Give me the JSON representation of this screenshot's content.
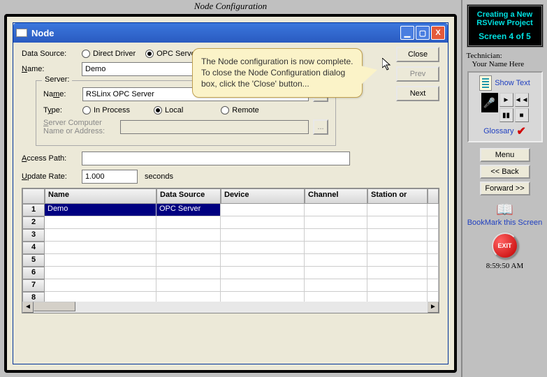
{
  "app_title": "Node Configuration",
  "window": {
    "title": "Node",
    "min_icon": "▁",
    "max_icon": "▢",
    "close_icon": "X"
  },
  "form": {
    "data_source_label": "Data Source:",
    "ds_direct": "Direct Driver",
    "ds_opc": "OPC Server",
    "name_label": "Name:",
    "name_value": "Demo",
    "server_group": "Server:",
    "server_name_label": "Name:",
    "server_name_value": "RSLinx OPC Server",
    "type_label": "Type:",
    "type_inproc": "In Process",
    "type_local": "Local",
    "type_remote": "Remote",
    "server_addr_label": "Server Computer\nName or Address:",
    "server_addr_value": "",
    "access_path_label": "Access Path:",
    "access_path_value": "",
    "update_rate_label": "Update Rate:",
    "update_rate_value": "1.000",
    "update_rate_unit": "seconds",
    "browse": "..."
  },
  "buttons": {
    "close": "Close",
    "prev": "Prev",
    "next": "Next"
  },
  "grid": {
    "headers": {
      "c2": "Name",
      "c3": "Data Source",
      "c4": "Device",
      "c5": "Channel",
      "c6": "Station or"
    },
    "rows": [
      {
        "n": "1",
        "name": "Demo",
        "ds": "OPC Server",
        "dev": "",
        "ch": "",
        "st": "",
        "selected": true
      },
      {
        "n": "2",
        "name": "",
        "ds": "",
        "dev": "",
        "ch": "",
        "st": "",
        "selected": false
      },
      {
        "n": "3",
        "name": "",
        "ds": "",
        "dev": "",
        "ch": "",
        "st": "",
        "selected": false
      },
      {
        "n": "4",
        "name": "",
        "ds": "",
        "dev": "",
        "ch": "",
        "st": "",
        "selected": false
      },
      {
        "n": "5",
        "name": "",
        "ds": "",
        "dev": "",
        "ch": "",
        "st": "",
        "selected": false
      },
      {
        "n": "6",
        "name": "",
        "ds": "",
        "dev": "",
        "ch": "",
        "st": "",
        "selected": false
      },
      {
        "n": "7",
        "name": "",
        "ds": "",
        "dev": "",
        "ch": "",
        "st": "",
        "selected": false
      },
      {
        "n": "8",
        "name": "",
        "ds": "",
        "dev": "",
        "ch": "",
        "st": "",
        "selected": false
      }
    ],
    "scroll_left": "◄",
    "scroll_right": "►"
  },
  "callout_text": "The Node configuration is now complete.  To close the Node Configuration dialog box, click the 'Close' button...",
  "right": {
    "lesson_title": "Creating a New RSView Project",
    "screen_label": "Screen 4 of 5",
    "tech_label": "Technician:",
    "tech_name": "Your Name Here",
    "show_text": "Show Text",
    "glossary": "Glossary",
    "menu": "Menu",
    "back": "<< Back",
    "forward": "Forward >>",
    "bookmark": "BookMark this Screen",
    "exit": "EXIT",
    "time": "8:59:50 AM",
    "play": "►",
    "rew": "◄◄",
    "pause": "▮▮",
    "stop": "■"
  }
}
